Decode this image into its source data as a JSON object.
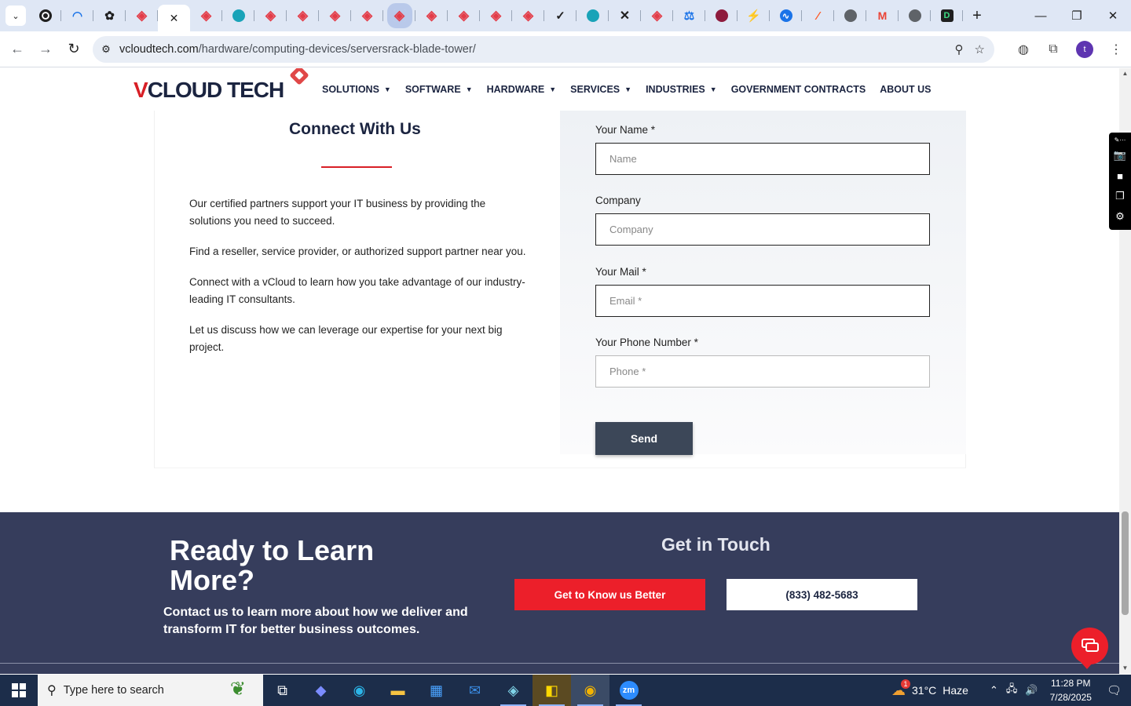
{
  "browser": {
    "tab_count_icons": [
      "tab-search-icon",
      "chatgpt-icon",
      "analytics-icon",
      "openai-icon",
      "diamond-icon"
    ],
    "active_tab_close": "✕",
    "new_tab_label": "+",
    "window": {
      "minimize": "—",
      "restore": "❐",
      "close": "✕"
    },
    "url_host": "vcloudtech.com",
    "url_path": "/hardware/computing-devices/serversrack-blade-tower/",
    "profile_initial": "t"
  },
  "site": {
    "logo_text_a": "V",
    "logo_text_b": "CLOUD TECH",
    "nav": [
      {
        "label": "SOLUTIONS",
        "caret": true
      },
      {
        "label": "SOFTWARE",
        "caret": true
      },
      {
        "label": "HARDWARE",
        "caret": true
      },
      {
        "label": "SERVICES",
        "caret": true
      },
      {
        "label": "INDUSTRIES",
        "caret": true
      },
      {
        "label": "GOVERNMENT CONTRACTS",
        "caret": false
      },
      {
        "label": "ABOUT US",
        "caret": false
      }
    ]
  },
  "connect": {
    "title": "Connect With Us",
    "paragraphs": [
      "Our certified partners support your IT business by providing the solutions you need to succeed.",
      "Find a reseller, service provider, or authorized support partner near you.",
      "Connect with a vCloud to learn how you take advantage of our industry-leading IT consultants.",
      "Let us discuss how we can leverage our expertise for your next big project."
    ]
  },
  "form": {
    "name_label": "Your Name *",
    "name_placeholder": "Name",
    "company_label": "Company",
    "company_placeholder": "Company",
    "mail_label": "Your Mail *",
    "mail_placeholder": "Email *",
    "phone_label": "Your Phone Number *",
    "phone_placeholder": "Phone *",
    "send_label": "Send"
  },
  "cta": {
    "title": "Ready to Learn More?",
    "subtitle": "Contact us to learn more about how we deliver and transform IT for better business outcomes.",
    "get_in_touch": "Get in Touch",
    "know_us_label": "Get to Know us Better",
    "phone_label": "(833) 482-5683"
  },
  "taskbar": {
    "search_placeholder": "Type here to search",
    "weather_temp": "31°C",
    "weather_desc": "Haze",
    "weather_badge": "1",
    "time": "11:28 PM",
    "date": "7/28/2025"
  },
  "colors": {
    "brand_navy": "#1b2440",
    "brand_red": "#d81f26",
    "cta_bg": "#363d5c",
    "send_bg": "#3c4758"
  }
}
